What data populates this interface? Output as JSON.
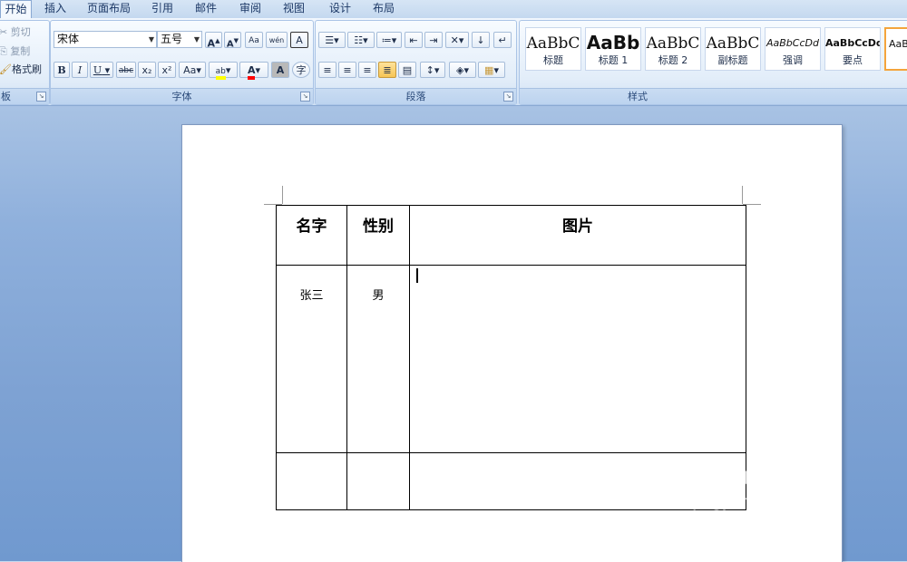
{
  "tabs": [
    {
      "label": "开始",
      "active": true
    },
    {
      "label": "插入"
    },
    {
      "label": "页面布局"
    },
    {
      "label": "引用"
    },
    {
      "label": "邮件"
    },
    {
      "label": "审阅"
    },
    {
      "label": "视图"
    },
    {
      "label": "设计"
    },
    {
      "label": "布局"
    }
  ],
  "clipboard": {
    "cut": "剪切",
    "copy": "复制",
    "format_painter": "格式刷",
    "group_label": "板"
  },
  "font": {
    "name": "宋体",
    "size": "五号",
    "group_label": "字体",
    "grow": "A",
    "shrink": "A",
    "clear": "Aa",
    "phonetic": "wén",
    "border_char": "A",
    "bold": "B",
    "italic": "I",
    "underline": "U",
    "strike": "abc",
    "subscript": "x₂",
    "superscript": "x²",
    "change_case": "Aa",
    "highlight": "ab",
    "font_color": "A",
    "shading_char": "A",
    "enclose": "字"
  },
  "paragraph": {
    "group_label": "段落"
  },
  "styles": {
    "group_label": "样式",
    "items": [
      {
        "sample": "AaBbC",
        "name": "标题"
      },
      {
        "sample": "AaBb",
        "name": "标题 1"
      },
      {
        "sample": "AaBbC",
        "name": "标题 2"
      },
      {
        "sample": "AaBbC",
        "name": "副标题"
      },
      {
        "sample": "AaBbCcDd",
        "name": "强调"
      },
      {
        "sample": "AaBbCcDd",
        "name": "要点"
      },
      {
        "sample": "AaB",
        "name": "↵"
      }
    ]
  },
  "table": {
    "headers": [
      "名字",
      "性别",
      "图片"
    ],
    "rows": [
      [
        "张三",
        "男",
        ""
      ],
      [
        "",
        "",
        ""
      ]
    ]
  },
  "watermark": {
    "brand": "Baidu经验",
    "url": "jingyan.baidu.com"
  },
  "colors": {
    "highlight": "#ffff00",
    "font_color": "#ff0000",
    "accent": "#f4a43c"
  }
}
